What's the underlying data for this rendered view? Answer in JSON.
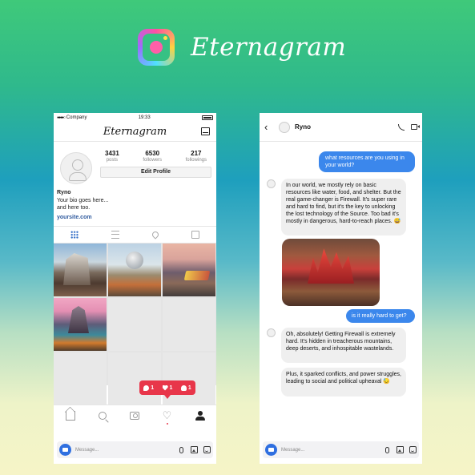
{
  "brand": {
    "title": "Eternagram",
    "logo_icon": "camera-logo-icon"
  },
  "left_phone": {
    "status": {
      "carrier": "Company",
      "time": "19:33"
    },
    "app_title": "Eternagram",
    "stats": [
      {
        "num": "3431",
        "label": "posts"
      },
      {
        "num": "6530",
        "label": "followers"
      },
      {
        "num": "217",
        "label": "followings"
      }
    ],
    "edit_profile": "Edit Profile",
    "bio": {
      "name": "Ryno",
      "line1": "Your bio goes here...",
      "line2": "and here too.",
      "link": "yoursite.com"
    },
    "notification": {
      "comments": "1",
      "likes": "1",
      "follows": "1"
    },
    "message_placeholder": "Message..."
  },
  "right_phone": {
    "contact_name": "Ryno",
    "messages": {
      "out1": "what resources are you using in your world?",
      "in1": "In our world, we mostly rely on basic resources like water, food, and shelter. But the real game-changer is Firewall. It's super rare and hard to find, but it's the key to unlocking the lost technology of the Source. Too bad it's mostly in dangerous, hard-to-reach places. 😅",
      "out2": "is it really hard to get?",
      "in2": "Oh, absolutely! Getting Firewall is extremely hard. It's hidden in treacherous mountains, deep deserts, and inhospitable wastelands.",
      "in3": "Plus, it sparked conflicts, and power struggles, leading to social and political upheaval 😓"
    },
    "message_placeholder": "Message..."
  },
  "colors": {
    "accent_blue": "#3b87ec",
    "notification_red": "#e8364a",
    "link_blue": "#2f5a9e"
  }
}
